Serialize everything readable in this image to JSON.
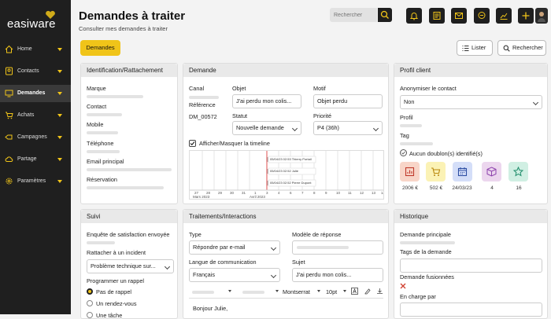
{
  "app": {
    "logo": "easiware"
  },
  "nav": [
    {
      "label": "Home",
      "icon": "home-icon"
    },
    {
      "label": "Contacts",
      "icon": "contacts-icon"
    },
    {
      "label": "Demandes",
      "icon": "monitor-icon"
    },
    {
      "label": "Achats",
      "icon": "cart-icon"
    },
    {
      "label": "Campagnes",
      "icon": "campaign-icon"
    },
    {
      "label": "Partage",
      "icon": "cloud-icon"
    },
    {
      "label": "Paramètres",
      "icon": "gear-icon"
    }
  ],
  "header": {
    "title": "Demandes à traiter",
    "subtitle": "Consulter mes demandes à traiter"
  },
  "search": {
    "placeholder": "Rechercher"
  },
  "toolbar_icons": [
    "bell-icon",
    "notes-icon",
    "mail-icon",
    "chat-icon",
    "chart-icon",
    "plus-icon"
  ],
  "tabs": {
    "demandes": "Demandes"
  },
  "actions": {
    "lister": "Lister",
    "rechercher": "Rechercher"
  },
  "identification": {
    "title": "Identification/Rattachement",
    "fields": [
      "Marque",
      "Contact",
      "Mobile",
      "Téléphone",
      "Email principal",
      "Réservation"
    ]
  },
  "demande": {
    "title": "Demande",
    "canal_label": "Canal",
    "objet_label": "Objet",
    "objet_value": "J'ai perdu mon colis...",
    "motif_label": "Motif",
    "motif_value": "Objet perdu",
    "reference_label": "Référence",
    "reference_value": "DM_00572",
    "statut_label": "Statut",
    "statut_value": "Nouvelle demande",
    "priorite_label": "Priorité",
    "priorite_value": "P4 (36h)",
    "timeline_toggle": "Afficher/Masquer la timeline",
    "timeline": {
      "events": [
        "05/04/23 02:53 Thierry Portail",
        "05/04/23 02:52 Julie",
        "05/04/23 02:52 Pierre Dupont"
      ],
      "ticks": [
        "27",
        "28",
        "29",
        "30",
        "31",
        "1",
        "3",
        "4",
        "6",
        "7",
        "8",
        "9",
        "10",
        "11",
        "12",
        "13",
        "14"
      ],
      "month_left": "Mars 2023",
      "month_right": "Avril 2023"
    }
  },
  "profil": {
    "title": "Profil client",
    "anonymiser_label": "Anonymiser le contact",
    "anonymiser_value": "Non",
    "profil_label": "Profil",
    "tag_label": "Tag",
    "doublon_text": "Aucun doublon(s) identifié(s)",
    "stats": [
      {
        "value": "2006 €",
        "icon": "report-icon",
        "color": "#f8d5c8"
      },
      {
        "value": "502 €",
        "icon": "cart-icon",
        "color": "#fbf2b5"
      },
      {
        "value": "24/03/23",
        "icon": "calendar-icon",
        "color": "#d4def8"
      },
      {
        "value": "4",
        "icon": "box-icon",
        "color": "#ecd6ee"
      },
      {
        "value": "16",
        "icon": "star-icon",
        "color": "#d0efe3"
      }
    ]
  },
  "suivi": {
    "title": "Suivi",
    "enquete_label": "Enquête de satisfaction envoyée",
    "incident_label": "Rattacher à un incident",
    "incident_value": "Problème technique sur...",
    "rappel_label": "Programmer un rappel",
    "radios": [
      "Pas de rappel",
      "Un rendez-vous",
      "Une tâche"
    ]
  },
  "traitements": {
    "title": "Traitements/Interactions",
    "type_label": "Type",
    "type_value": "Répondre par e-mail",
    "modele_label": "Modèle de réponse",
    "langue_label": "Langue de communication",
    "langue_value": "Français",
    "sujet_label": "Sujet",
    "sujet_value": "J'ai perdu mon colis...",
    "editor_font": "Montserrat",
    "editor_size": "10pt",
    "body_start": "Bonjour Julie,"
  },
  "historique": {
    "title": "Historique",
    "demande_principale": "Demande principale",
    "tags": "Tags de la demande",
    "fusionnees": "Demande fusionnées",
    "charge": "En charge par"
  }
}
